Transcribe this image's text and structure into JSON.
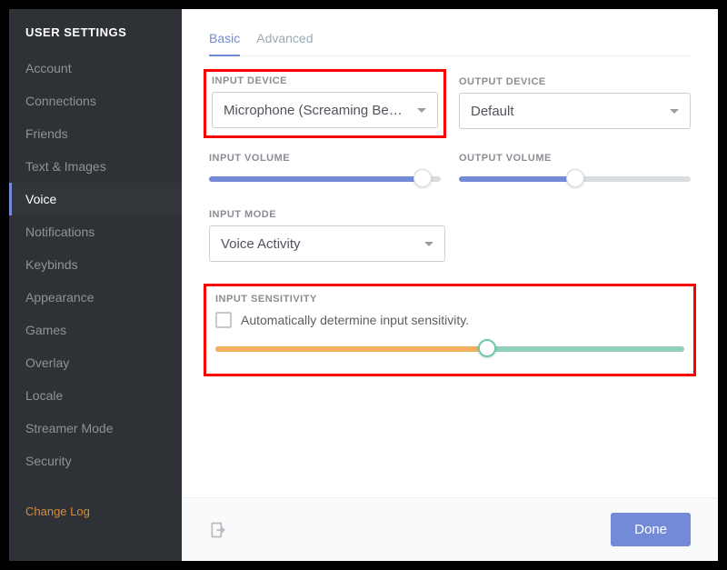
{
  "sidebar": {
    "title": "USER SETTINGS",
    "items": [
      {
        "label": "Account"
      },
      {
        "label": "Connections"
      },
      {
        "label": "Friends"
      },
      {
        "label": "Text & Images"
      },
      {
        "label": "Voice"
      },
      {
        "label": "Notifications"
      },
      {
        "label": "Keybinds"
      },
      {
        "label": "Appearance"
      },
      {
        "label": "Games"
      },
      {
        "label": "Overlay"
      },
      {
        "label": "Locale"
      },
      {
        "label": "Streamer Mode"
      },
      {
        "label": "Security"
      }
    ],
    "active_index": 4,
    "changelog": "Change Log"
  },
  "tabs": {
    "items": [
      {
        "label": "Basic"
      },
      {
        "label": "Advanced"
      }
    ],
    "active_index": 0
  },
  "voice": {
    "input_device": {
      "label": "INPUT DEVICE",
      "value": "Microphone (Screaming Bee ..."
    },
    "output_device": {
      "label": "OUTPUT DEVICE",
      "value": "Default"
    },
    "input_volume": {
      "label": "INPUT VOLUME",
      "value_pct": 92
    },
    "output_volume": {
      "label": "OUTPUT VOLUME",
      "value_pct": 50
    },
    "input_mode": {
      "label": "INPUT MODE",
      "value": "Voice Activity"
    },
    "input_sensitivity": {
      "label": "INPUT SENSITIVITY",
      "auto_label": "Automatically determine input sensitivity.",
      "auto_checked": false,
      "value_pct": 58
    }
  },
  "footer": {
    "done": "Done"
  },
  "colors": {
    "accent": "#738bd7",
    "sidebar_bg": "#2e3136",
    "highlight": "#ff0000",
    "sens_low": "#f0b060",
    "sens_high": "#8fd1b7"
  }
}
